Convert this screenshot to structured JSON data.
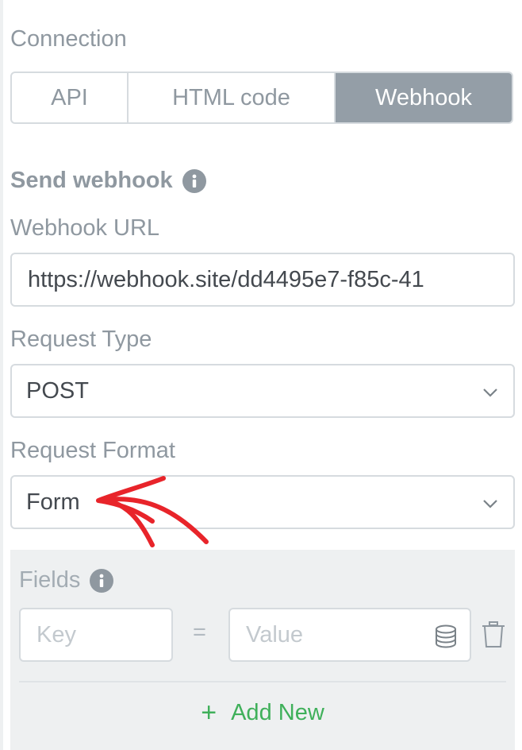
{
  "connection": {
    "label": "Connection",
    "tabs": [
      "API",
      "HTML code",
      "Webhook"
    ],
    "active_tab": "Webhook"
  },
  "send_webhook": {
    "label": "Send webhook"
  },
  "webhook_url": {
    "label": "Webhook URL",
    "value": "https://webhook.site/dd4495e7-f85c-41"
  },
  "request_type": {
    "label": "Request Type",
    "value": "POST"
  },
  "request_format": {
    "label": "Request Format",
    "value": "Form"
  },
  "fields": {
    "label": "Fields",
    "key_placeholder": "Key",
    "equals": "=",
    "value_placeholder": "Value",
    "add_new_label": "Add New",
    "add_new_icon": "+"
  },
  "colors": {
    "active_tab_bg": "#949ea7",
    "add_new": "#3fb05a",
    "annotation_arrow": "#e8242a"
  },
  "icons": [
    "info-icon",
    "chevron-down-icon",
    "database-icon",
    "trash-icon",
    "plus-icon",
    "arrow-annotation"
  ]
}
